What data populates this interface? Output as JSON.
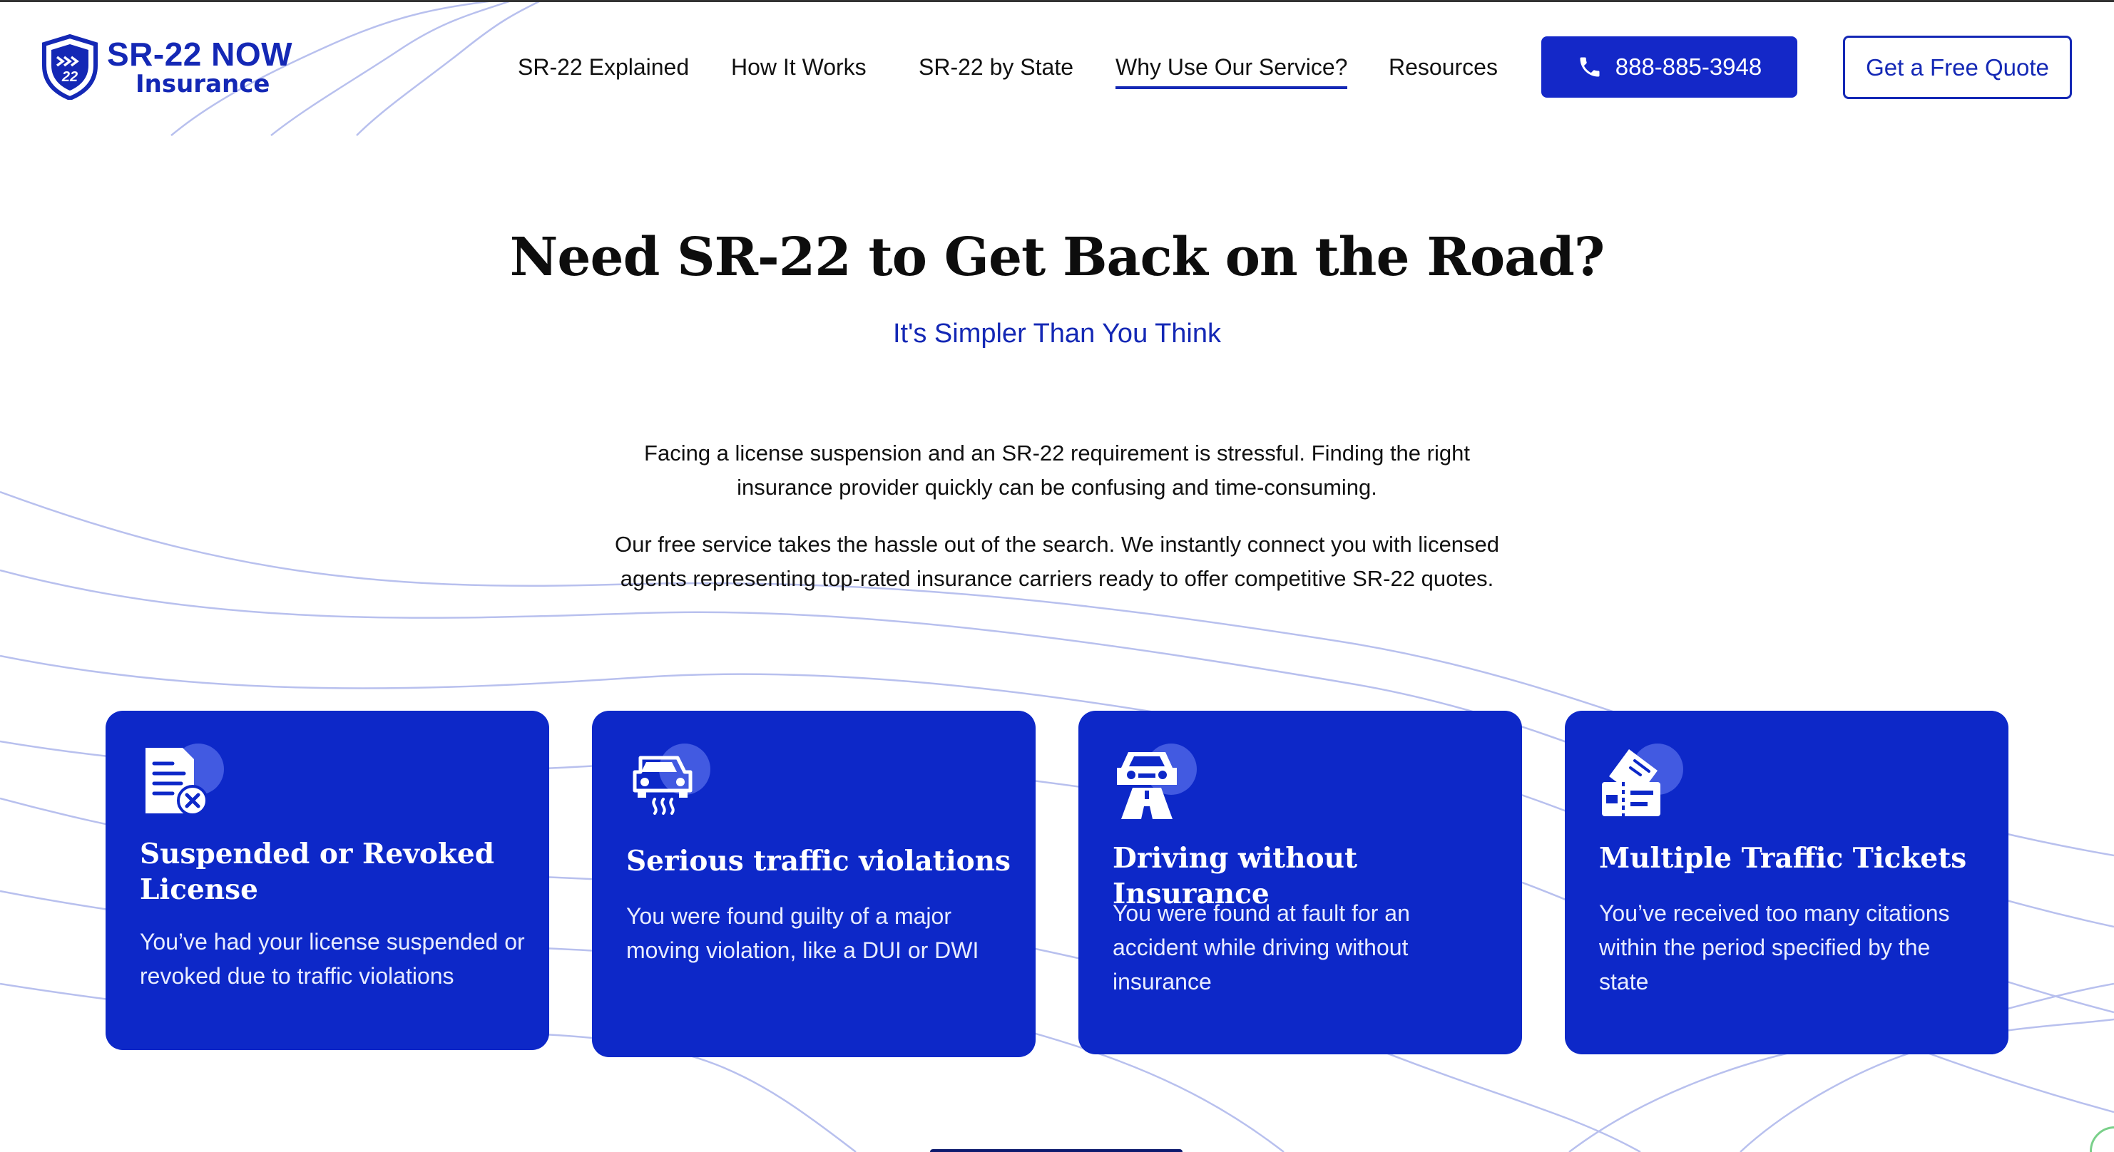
{
  "brand": {
    "logo_top": "SR-22 NOW",
    "logo_bottom": "Insurance",
    "shield_text": "22",
    "primary_color": "#1428b5",
    "card_color": "#0d28c8"
  },
  "nav": {
    "items": [
      {
        "label": "SR-22 Explained",
        "active": false
      },
      {
        "label": "How It Works",
        "active": false
      },
      {
        "label": "SR-22 by State",
        "active": false
      },
      {
        "label": "Why Use Our Service?",
        "active": true
      },
      {
        "label": "Resources",
        "active": false
      }
    ],
    "phone": "888-885-3948",
    "phone_icon": "phone-icon",
    "quote_label": "Get a Free Quote"
  },
  "hero": {
    "title": "Need SR-22 to Get Back on the Road?",
    "subtitle": "It's Simpler Than You Think"
  },
  "intro": {
    "p1": "Facing a license suspension and an SR-22 requirement is stressful. Finding the right insurance provider quickly can be confusing and time-consuming.",
    "p2": "Our free service takes the hassle out of the search. We instantly connect you with licensed agents representing top-rated insurance carriers ready to offer competitive SR-22 quotes."
  },
  "cards": [
    {
      "icon": "document-x-icon",
      "title": "Suspended or Revoked License",
      "text": "You’ve had your license suspended or revoked due to traffic violations"
    },
    {
      "icon": "car-skid-icon",
      "title": "Serious traffic violations",
      "text": "You were found guilty of a major moving violation, like a DUI or DWI"
    },
    {
      "icon": "car-road-icon",
      "title": "Driving without Insurance",
      "text": "You were found at fault for an accident while driving without insurance"
    },
    {
      "icon": "tickets-icon",
      "title": "Multiple Traffic Tickets",
      "text": "You’ve received too many citations within the period specified by the state"
    }
  ]
}
